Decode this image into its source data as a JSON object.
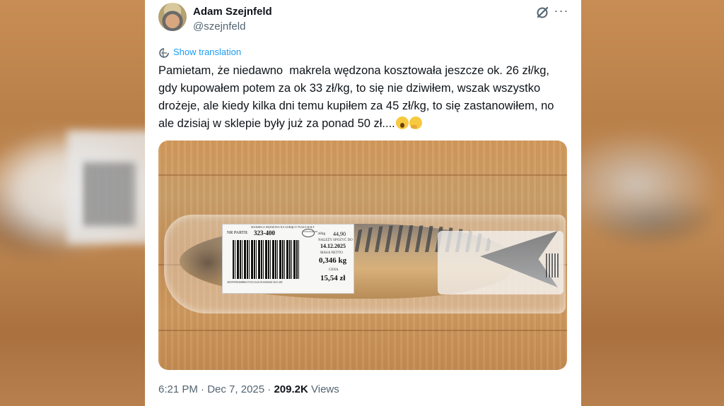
{
  "tweet": {
    "author_name": "Adam Szejnfeld",
    "author_handle": "@szejnfeld",
    "translate_label": "Show translation",
    "text": "Pamietam, że niedawno  makrela wędzona kosztowała jeszcze ok. 26 zł/kg, gdy kupowałem potem za ok 33 zł/kg, to się nie dziwiłem, wszak wszystko drożeje, ale kiedy kilka dni temu kupiłem za 45 zł/kg, to się zastanowiłem, no ale dzisiaj w sklepie były już za ponad 50 zł....",
    "emojis": [
      "astonished-face",
      "thinking-face"
    ],
    "time": "6:21 PM",
    "separator": "·",
    "date": "Dec 7, 2025",
    "views_count": "209.2K",
    "views_label": "Views"
  },
  "label": {
    "header": "MAKRELA WĘDZONA NA GORĄCO TUSZA BAŁT",
    "batch_label": "NR PARTII:",
    "batch_no": "323-400",
    "price_per_kg_label": "zł/kg",
    "price_per_kg": "44,90",
    "best_before_label": "NALEŻY SPOŻYĆ DO",
    "best_before": "14.12.2025",
    "net_mass_label": "MASA NETTO",
    "net_mass": "0,346 kg",
    "price_label": "CENA",
    "price": "15,54 zł",
    "logo_text": "GOSPODAR MS",
    "barcode_digits": "4815959594688661572512142103160034613323-400"
  },
  "colors": {
    "link": "#1d9bf0",
    "text_primary": "#0f1419",
    "text_secondary": "#536471"
  },
  "icons": [
    "grok-icon",
    "more-icon",
    "translate-icon"
  ]
}
